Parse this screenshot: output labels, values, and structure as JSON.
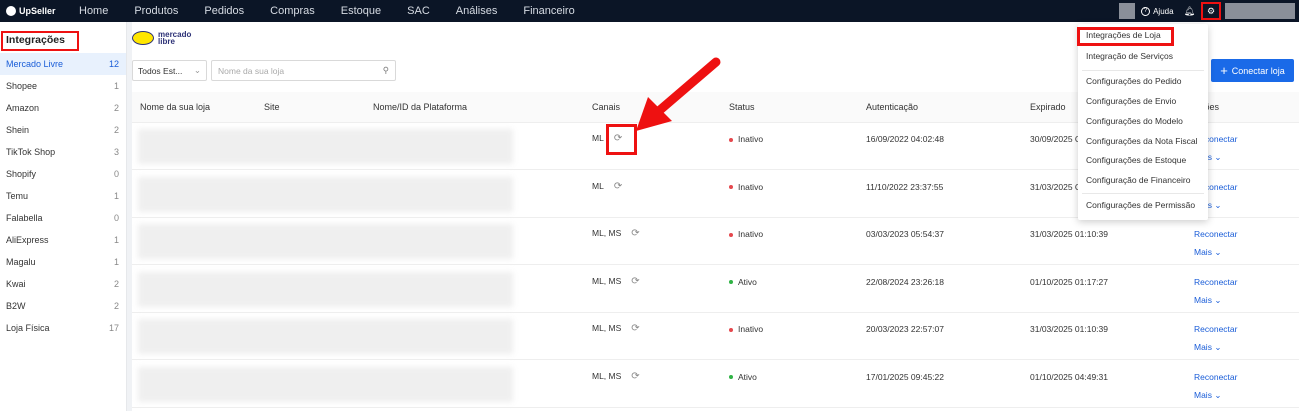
{
  "app": {
    "brand": "UpSeller"
  },
  "topnav": {
    "items": [
      "Home",
      "Produtos",
      "Pedidos",
      "Compras",
      "Estoque",
      "SAC",
      "Análises",
      "Financeiro"
    ],
    "help_label": "Ajuda"
  },
  "sidebar": {
    "title": "Integrações",
    "items": [
      {
        "label": "Mercado Livre",
        "count": "12"
      },
      {
        "label": "Shopee",
        "count": "1"
      },
      {
        "label": "Amazon",
        "count": "2"
      },
      {
        "label": "Shein",
        "count": "2"
      },
      {
        "label": "TikTok Shop",
        "count": "3"
      },
      {
        "label": "Shopify",
        "count": "0"
      },
      {
        "label": "Temu",
        "count": "1"
      },
      {
        "label": "Falabella",
        "count": "0"
      },
      {
        "label": "AliExpress",
        "count": "1"
      },
      {
        "label": "Magalu",
        "count": "1"
      },
      {
        "label": "Kwai",
        "count": "2"
      },
      {
        "label": "B2W",
        "count": "2"
      },
      {
        "label": "Loja Física",
        "count": "17"
      }
    ]
  },
  "main": {
    "marketplace_logo_line1": "mercado",
    "marketplace_logo_line2": "libre",
    "filter_value": "Todos Est...",
    "search_placeholder": "Nome da sua loja",
    "connect_button": "Conectar loja",
    "columns": [
      "Nome da sua loja",
      "Site",
      "Nome/ID da Plataforma",
      "Canais",
      "Status",
      "Autenticação",
      "Expirado",
      "Ações"
    ],
    "action_reconnect": "Reconectar",
    "action_more": "Mais",
    "rows": [
      {
        "canais": "ML",
        "status": "Inativo",
        "status_color": "#e5484d",
        "auth": "16/09/2022 04:02:48",
        "expira": "30/09/2025 C"
      },
      {
        "canais": "ML",
        "status": "Inativo",
        "status_color": "#e5484d",
        "auth": "11/10/2022 23:37:55",
        "expira": "31/03/2025 C"
      },
      {
        "canais": "ML, MS",
        "status": "Inativo",
        "status_color": "#e5484d",
        "auth": "03/03/2023 05:54:37",
        "expira": "31/03/2025 01:10:39"
      },
      {
        "canais": "ML, MS",
        "status": "Ativo",
        "status_color": "#2fb344",
        "auth": "22/08/2024 23:26:18",
        "expira": "01/10/2025 01:17:27"
      },
      {
        "canais": "ML, MS",
        "status": "Inativo",
        "status_color": "#e5484d",
        "auth": "20/03/2023 22:57:07",
        "expira": "31/03/2025 01:10:39"
      },
      {
        "canais": "ML, MS",
        "status": "Ativo",
        "status_color": "#2fb344",
        "auth": "17/01/2025 09:45:22",
        "expira": "01/10/2025 04:49:31"
      }
    ]
  },
  "settings_menu": {
    "items": [
      "Integrações de Loja",
      "Integração de Serviços",
      "Configurações do Pedido",
      "Configurações de Envio",
      "Configurações do Modelo",
      "Configurações da Nota Fiscal",
      "Configurações de Estoque",
      "Configuração de Financeiro",
      "Configurações de Permissão"
    ]
  },
  "colors": {
    "topnav": "#0b1526",
    "accent": "#1a6ae8",
    "highlight": "#e11111"
  }
}
